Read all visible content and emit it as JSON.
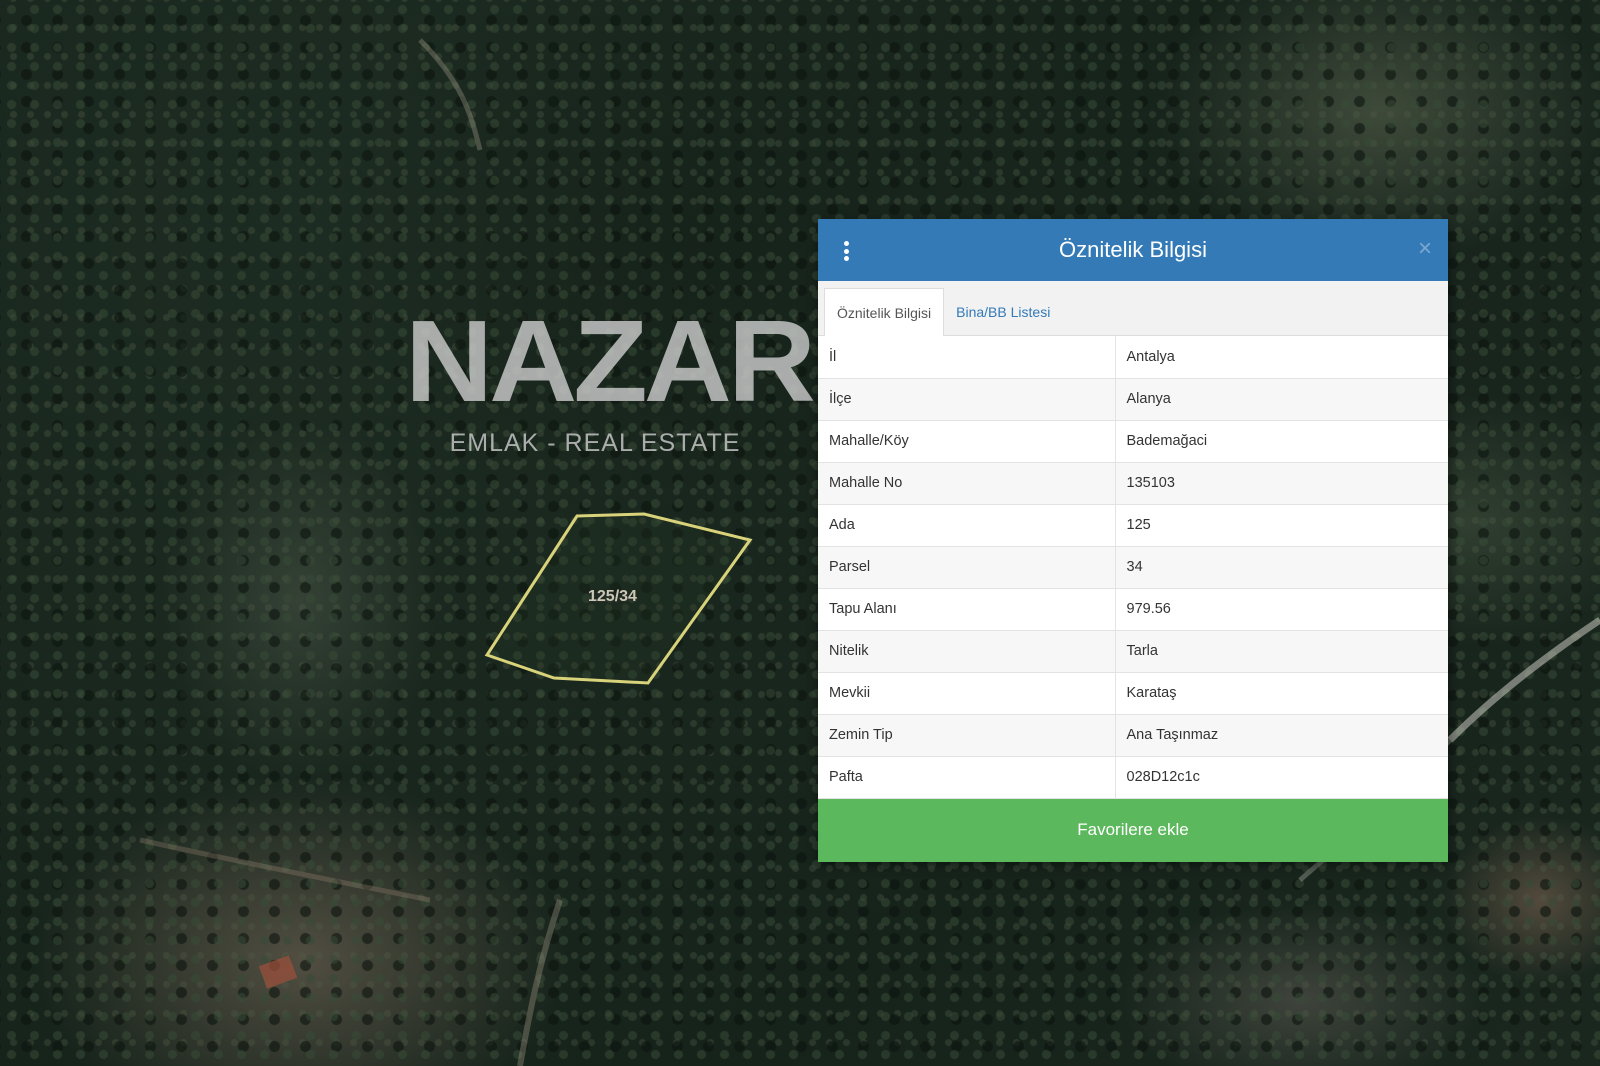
{
  "watermark": {
    "word": "NAZAR",
    "subtitle": "EMLAK - REAL ESTATE"
  },
  "parcel": {
    "label": "125/34"
  },
  "panel": {
    "title": "Öznitelik Bilgisi",
    "menu_icon": "vertical-dots-icon",
    "close_icon": "close-icon",
    "close_glyph": "×",
    "tabs": [
      {
        "label": "Öznitelik Bilgisi",
        "active": true
      },
      {
        "label": "Bina/BB Listesi",
        "active": false
      }
    ],
    "rows": [
      {
        "key": "İl",
        "value": "Antalya"
      },
      {
        "key": "İlçe",
        "value": "Alanya"
      },
      {
        "key": "Mahalle/Köy",
        "value": "Bademağaci"
      },
      {
        "key": "Mahalle No",
        "value": "135103"
      },
      {
        "key": "Ada",
        "value": "125"
      },
      {
        "key": "Parsel",
        "value": "34"
      },
      {
        "key": "Tapu Alanı",
        "value": "979.56"
      },
      {
        "key": "Nitelik",
        "value": "Tarla"
      },
      {
        "key": "Mevkii",
        "value": "Karataş"
      },
      {
        "key": "Zemin Tip",
        "value": "Ana Taşınmaz"
      },
      {
        "key": "Pafta",
        "value": "028D12c1c"
      }
    ],
    "favorite_button": "Favorilere ekle"
  },
  "colors": {
    "header": "#337ab7",
    "button": "#5cb85c",
    "parcel_outline": "#d8d27a"
  }
}
